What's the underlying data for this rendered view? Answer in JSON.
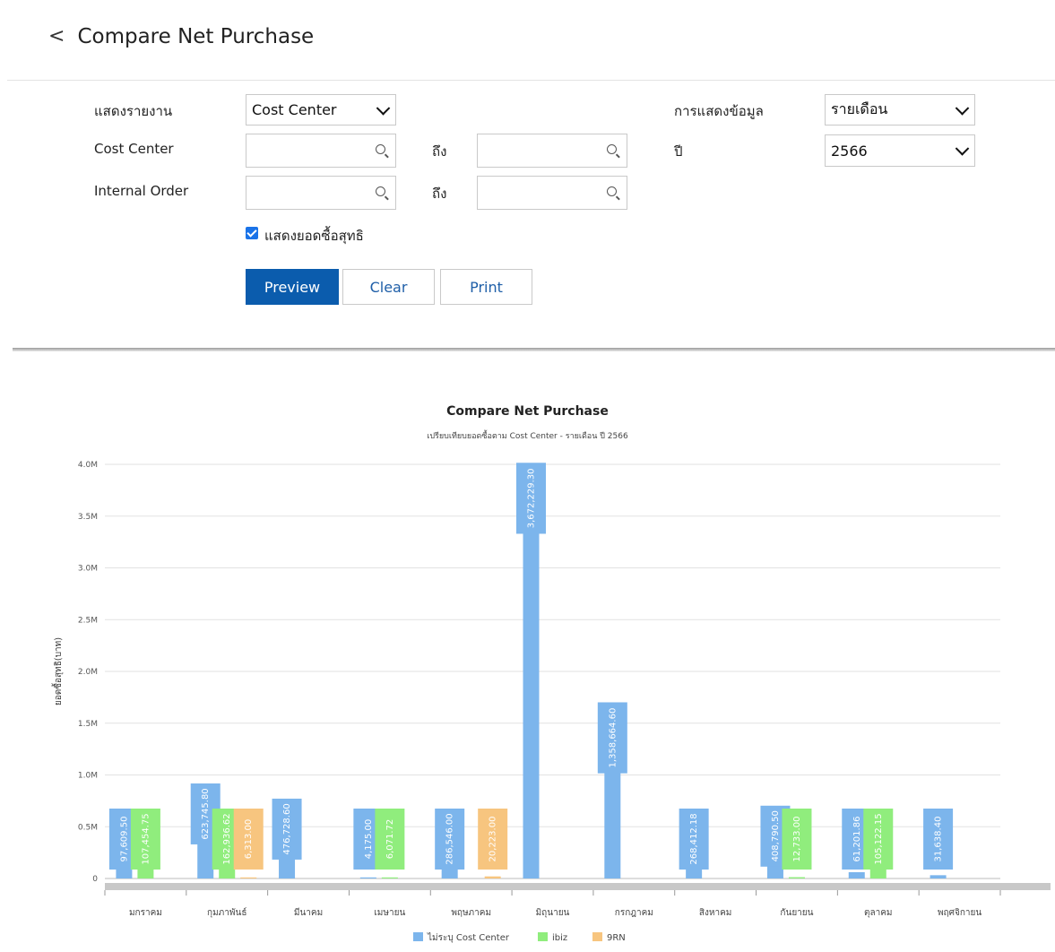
{
  "header": {
    "back_icon": "chevron-left-icon",
    "back_glyph": "<",
    "title": "Compare Net Purchase"
  },
  "form": {
    "report_label": "แสดงรายงาน",
    "report_value": "Cost Center",
    "display_label": "การแสดงข้อมูล",
    "display_value": "รายเดือน",
    "cost_center_label": "Cost Center",
    "cost_center_to_label": "ถึง",
    "year_label": "ปี",
    "year_value": "2566",
    "internal_order_label": "Internal Order",
    "internal_order_to_label": "ถึง",
    "show_net_label": "แสดงยอดซื้อสุทธิ",
    "show_net_checked": true,
    "preview_label": "Preview",
    "clear_label": "Clear",
    "print_label": "Print",
    "primary_color": "#0b5cad"
  },
  "chart_data": {
    "type": "bar",
    "title": "Compare Net Purchase",
    "subtitle": "เปรียบเทียบยอดซื้อตาม Cost Center - รายเดือน ปี 2566",
    "ylabel": "ยอดซื้อสุทธิ(บาท)",
    "ylim": [
      0,
      4000000
    ],
    "yticks": [
      "0",
      "0.5M",
      "1.0M",
      "1.5M",
      "2.0M",
      "2.5M",
      "3.0M",
      "3.5M",
      "4.0M"
    ],
    "grid": true,
    "legend_position": "bottom",
    "categories": [
      "มกราคม",
      "กุมภาพันธ์",
      "มีนาคม",
      "เมษายน",
      "พฤษภาคม",
      "มิถุนายน",
      "กรกฎาคม",
      "สิงหาคม",
      "กันยายน",
      "ตุลาคม",
      "พฤศจิกายน"
    ],
    "series": [
      {
        "name": "ไม่ระบุ Cost Center",
        "color": "#7cb5ec",
        "values": [
          97609.5,
          623745.8,
          476728.6,
          4175.0,
          286546.0,
          3672229.3,
          1358664.6,
          268412.18,
          408790.5,
          61201.86,
          31638.4
        ],
        "labels": [
          "97,609.50",
          "623,745.80",
          "476,728.60",
          "4,175.00",
          "286,546.00",
          "3,672,229.30",
          "1,358,664.60",
          "268,412.18",
          "408,790.50",
          "61,201.86",
          "31,638.40"
        ]
      },
      {
        "name": "ibiz",
        "color": "#90ed7d",
        "values": [
          107454.75,
          162936.62,
          null,
          6071.72,
          null,
          null,
          null,
          null,
          12733.0,
          105122.15,
          null
        ],
        "labels": [
          "107,454.75",
          "162,936.62",
          "",
          "6,071.72",
          "",
          "",
          "",
          "",
          "12,733.00",
          "105,122.15",
          ""
        ]
      },
      {
        "name": "9RN",
        "color": "#f7c57f",
        "values": [
          null,
          6313.0,
          null,
          null,
          20223.0,
          null,
          null,
          null,
          null,
          null,
          null
        ],
        "labels": [
          "",
          "6,313.00",
          "",
          "",
          "20,223.00",
          "",
          "",
          "",
          "",
          "",
          ""
        ]
      }
    ]
  }
}
